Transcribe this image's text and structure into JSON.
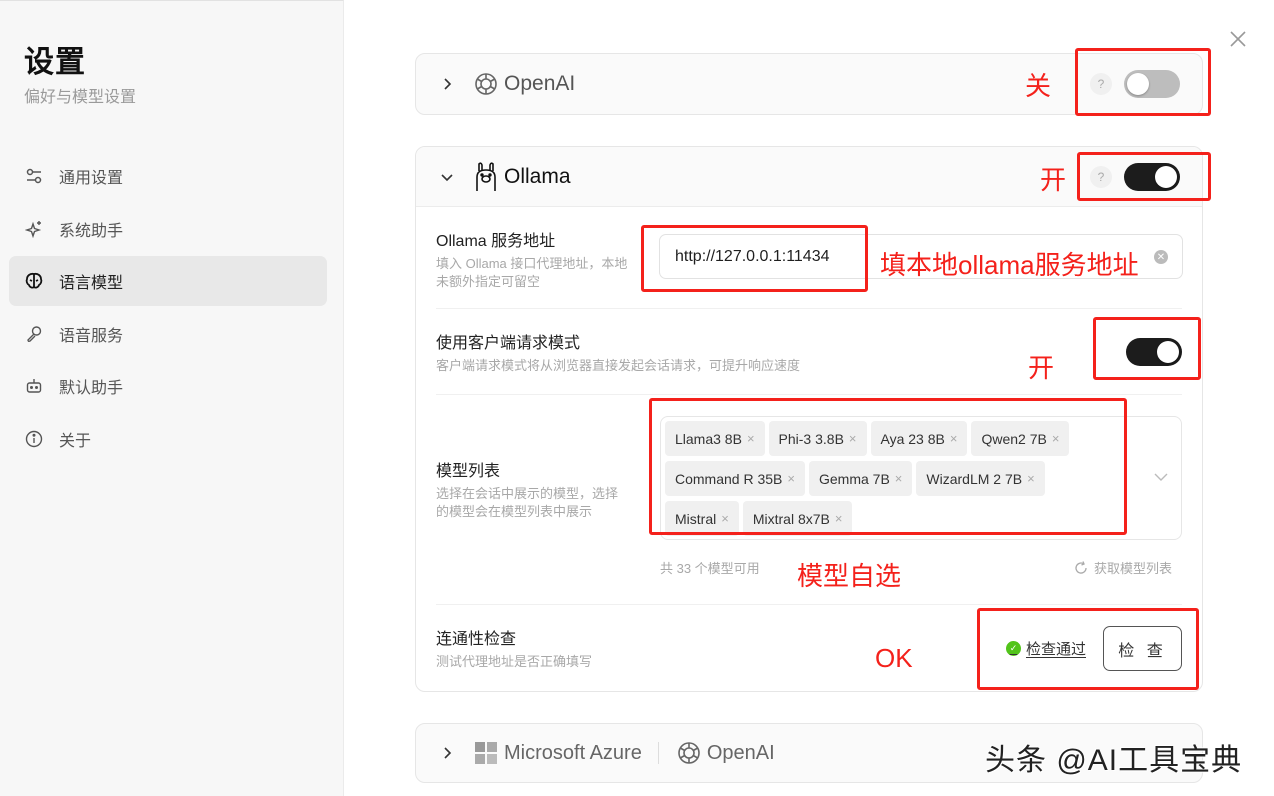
{
  "sidebar": {
    "title": "设置",
    "subtitle": "偏好与模型设置",
    "items": [
      {
        "label": "通用设置",
        "icon": "sliders-icon",
        "active": false
      },
      {
        "label": "系统助手",
        "icon": "sparkles-icon",
        "active": false
      },
      {
        "label": "语言模型",
        "icon": "brain-icon",
        "active": true
      },
      {
        "label": "语音服务",
        "icon": "microphone-icon",
        "active": false
      },
      {
        "label": "默认助手",
        "icon": "bot-icon",
        "active": false
      },
      {
        "label": "关于",
        "icon": "info-icon",
        "active": false
      }
    ]
  },
  "providers": {
    "openai": {
      "name": "OpenAI",
      "help": "?",
      "enabled": false
    },
    "ollama": {
      "name": "Ollama",
      "help": "?",
      "enabled": true,
      "service_url": {
        "title": "Ollama 服务地址",
        "desc": "填入 Ollama 接口代理地址，本地未额外指定可留空",
        "value": "http://127.0.0.1:11434"
      },
      "client_mode": {
        "title": "使用客户端请求模式",
        "desc": "客户端请求模式将从浏览器直接发起会话请求，可提升响应速度",
        "enabled": true
      },
      "model_list": {
        "title": "模型列表",
        "desc": "选择在会话中展示的模型，选择的模型会在模型列表中展示",
        "tags": [
          "Llama3 8B",
          "Phi-3 3.8B",
          "Aya 23 8B",
          "Qwen2 7B",
          "Command R 35B",
          "Gemma 7B",
          "WizardLM 2 7B",
          "Mistral",
          "Mixtral 8x7B"
        ],
        "remove_glyph": "×",
        "count_text": "共 33 个模型可用",
        "fetch_label": "获取模型列表"
      },
      "connectivity": {
        "title": "连通性检查",
        "desc": "测试代理地址是否正确填写",
        "status": "检查通过",
        "button": "检 查"
      }
    },
    "azure": {
      "name": "Microsoft Azure",
      "sub_name": "OpenAI"
    }
  },
  "annotations": {
    "openai_off": "关",
    "ollama_on": "开",
    "url_hint": "填本地ollama服务地址",
    "client_on": "开",
    "models_hint": "模型自选",
    "ok": "OK"
  },
  "watermark": "头条 @AI工具宝典",
  "colors": {
    "accent_red": "#f4211b",
    "success": "#52c41a",
    "toggle_on": "#1c1c1c",
    "toggle_off": "#bdbdbd"
  }
}
